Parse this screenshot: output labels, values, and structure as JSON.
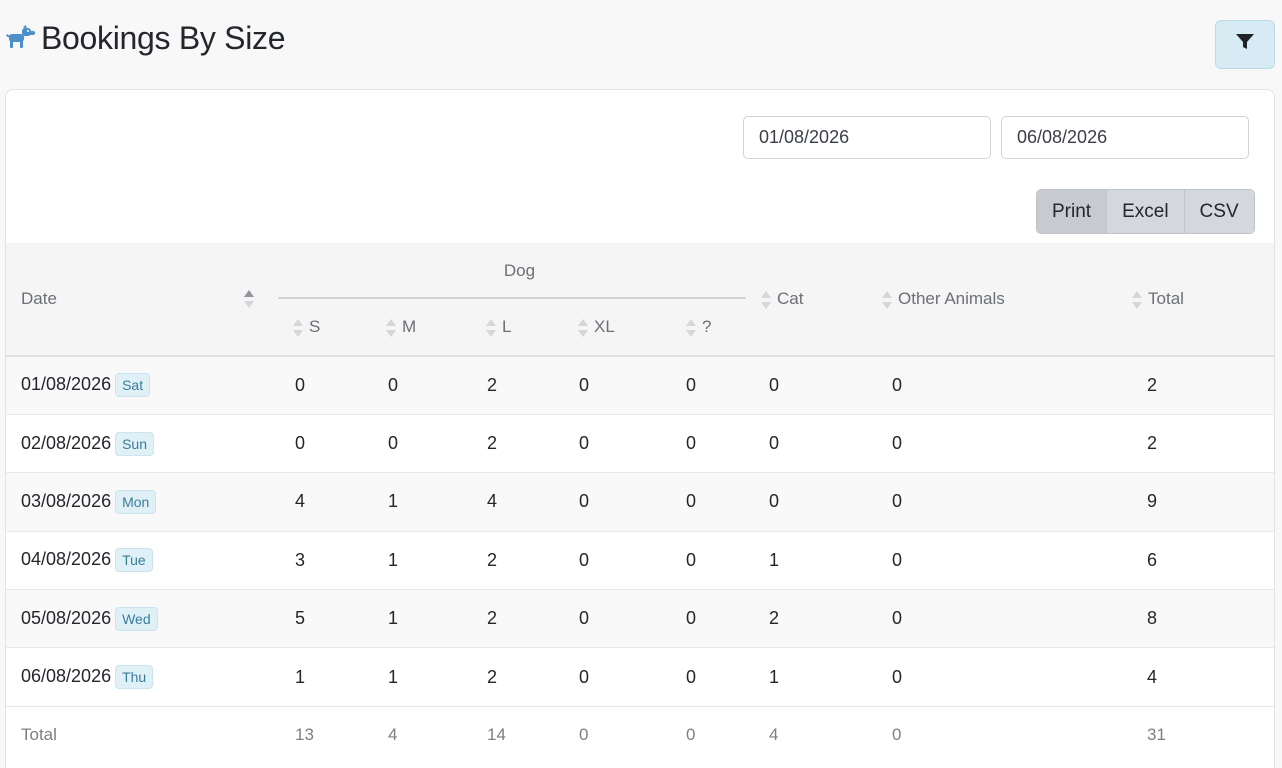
{
  "header": {
    "title": "Bookings By Size",
    "icon": "dog-icon",
    "filter_icon": "filter-icon"
  },
  "filters": {
    "date_from": "01/08/2026",
    "date_to": "06/08/2026"
  },
  "export_buttons": {
    "print": "Print",
    "excel": "Excel",
    "csv": "CSV"
  },
  "table": {
    "headers": {
      "date": "Date",
      "dog_group": "Dog",
      "s": "S",
      "m": "M",
      "l": "L",
      "xl": "XL",
      "unknown": "?",
      "cat": "Cat",
      "other": "Other Animals",
      "total": "Total"
    },
    "rows": [
      {
        "date": "01/08/2026",
        "day": "Sat",
        "s": "0",
        "m": "0",
        "l": "2",
        "xl": "0",
        "unknown": "0",
        "cat": "0",
        "other": "0",
        "total": "2"
      },
      {
        "date": "02/08/2026",
        "day": "Sun",
        "s": "0",
        "m": "0",
        "l": "2",
        "xl": "0",
        "unknown": "0",
        "cat": "0",
        "other": "0",
        "total": "2"
      },
      {
        "date": "03/08/2026",
        "day": "Mon",
        "s": "4",
        "m": "1",
        "l": "4",
        "xl": "0",
        "unknown": "0",
        "cat": "0",
        "other": "0",
        "total": "9"
      },
      {
        "date": "04/08/2026",
        "day": "Tue",
        "s": "3",
        "m": "1",
        "l": "2",
        "xl": "0",
        "unknown": "0",
        "cat": "1",
        "other": "0",
        "total": "6"
      },
      {
        "date": "05/08/2026",
        "day": "Wed",
        "s": "5",
        "m": "1",
        "l": "2",
        "xl": "0",
        "unknown": "0",
        "cat": "2",
        "other": "0",
        "total": "8"
      },
      {
        "date": "06/08/2026",
        "day": "Thu",
        "s": "1",
        "m": "1",
        "l": "2",
        "xl": "0",
        "unknown": "0",
        "cat": "1",
        "other": "0",
        "total": "4"
      }
    ],
    "totals": {
      "label": "Total",
      "s": "13",
      "m": "4",
      "l": "14",
      "xl": "0",
      "unknown": "0",
      "cat": "4",
      "other": "0",
      "total": "31"
    }
  },
  "colors": {
    "accent": "#d6ebf3",
    "badge_bg": "#dff0f6",
    "badge_text": "#3a7d99",
    "icon_blue": "#4f8fc9"
  }
}
